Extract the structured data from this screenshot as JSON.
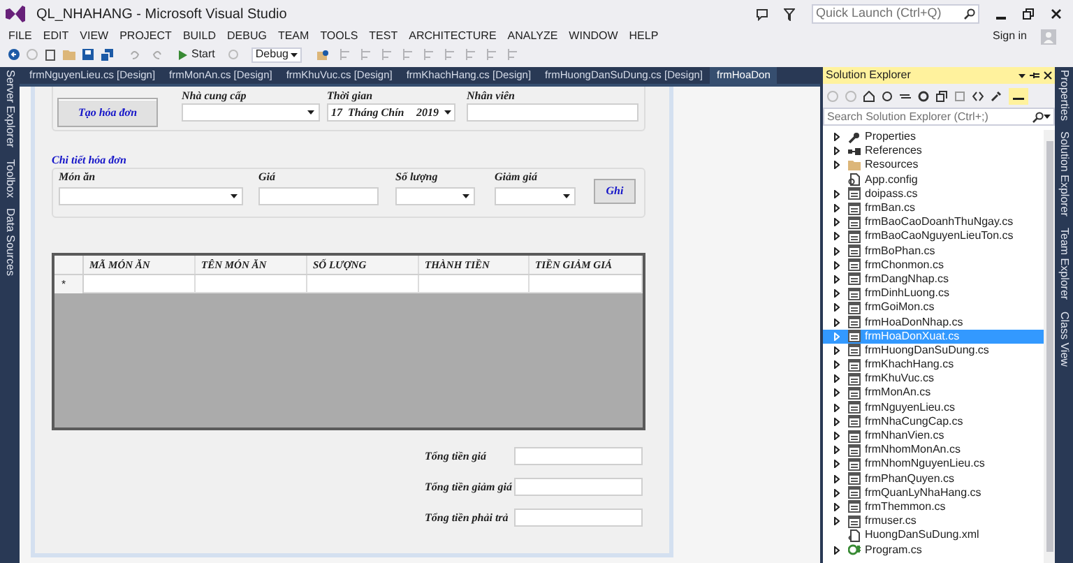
{
  "window": {
    "title": "QL_NHAHANG - Microsoft Visual Studio"
  },
  "quick_launch": {
    "placeholder": "Quick Launch (Ctrl+Q)"
  },
  "menu": [
    "FILE",
    "EDIT",
    "VIEW",
    "PROJECT",
    "BUILD",
    "DEBUG",
    "TEAM",
    "TOOLS",
    "TEST",
    "ARCHITECTURE",
    "ANALYZE",
    "WINDOW",
    "HELP"
  ],
  "sign_in": "Sign in",
  "toolbar": {
    "start": "Start",
    "configuration": "Debug"
  },
  "left_tool_tabs": [
    "Server Explorer",
    "Toolbox",
    "Data Sources"
  ],
  "document_tabs": [
    {
      "label": "frmNguyenLieu.cs [Design]",
      "selected": false
    },
    {
      "label": "frmMonAn.cs [Design]",
      "selected": false
    },
    {
      "label": "frmKhuVuc.cs [Design]",
      "selected": false
    },
    {
      "label": "frmKhachHang.cs [Design]",
      "selected": false
    },
    {
      "label": "frmHuongDanSuDung.cs [Design]",
      "selected": false
    },
    {
      "label": "frmHoaDon",
      "selected": true
    }
  ],
  "form": {
    "create_button": "Tạo hóa đơn",
    "top_fields": [
      {
        "label": "Nhà cung cấp",
        "kind": "combo"
      },
      {
        "label": "Thời gian",
        "kind": "date",
        "day": "17",
        "month": "Tháng Chín",
        "year": "2019"
      },
      {
        "label": "Nhân viên",
        "kind": "text"
      }
    ],
    "details": {
      "title": "Chi tiết hóa đơn",
      "fields": [
        {
          "label": "Món ăn",
          "kind": "combo"
        },
        {
          "label": "Giá",
          "kind": "text"
        },
        {
          "label": "Số lượng",
          "kind": "combo"
        },
        {
          "label": "Giảm giá",
          "kind": "combo"
        }
      ],
      "save_button": "Ghi"
    },
    "grid": {
      "columns": [
        "MÃ MÓN ĂN",
        "TÊN MÓN ĂN",
        "SỐ LƯỢNG",
        "THÀNH TIỀN",
        "TIỀN GIẢM GIÁ"
      ],
      "new_row_marker": "*"
    },
    "totals": [
      {
        "label": "Tổng tiền giá"
      },
      {
        "label": "Tổng tiền giảm giá"
      },
      {
        "label": "Tổng tiền phải trả"
      }
    ]
  },
  "solution_explorer": {
    "title": "Solution Explorer",
    "search": {
      "placeholder": "Search Solution Explorer (Ctrl+;)"
    },
    "items": [
      {
        "label": "Properties",
        "kind": "wrench",
        "expandable": true,
        "selected": false
      },
      {
        "label": "References",
        "kind": "references",
        "expandable": true,
        "selected": false
      },
      {
        "label": "Resources",
        "kind": "folder",
        "expandable": true,
        "selected": false
      },
      {
        "label": "App.config",
        "kind": "config",
        "expandable": false,
        "selected": false
      },
      {
        "label": "doipass.cs",
        "kind": "form",
        "expandable": true,
        "selected": false
      },
      {
        "label": "frmBan.cs",
        "kind": "form",
        "expandable": true,
        "selected": false
      },
      {
        "label": "frmBaoCaoDoanhThuNgay.cs",
        "kind": "form",
        "expandable": true,
        "selected": false
      },
      {
        "label": "frmBaoCaoNguyenLieuTon.cs",
        "kind": "form",
        "expandable": true,
        "selected": false
      },
      {
        "label": "frmBoPhan.cs",
        "kind": "form",
        "expandable": true,
        "selected": false
      },
      {
        "label": "frmChonmon.cs",
        "kind": "form",
        "expandable": true,
        "selected": false
      },
      {
        "label": "frmDangNhap.cs",
        "kind": "form",
        "expandable": true,
        "selected": false
      },
      {
        "label": "frmDinhLuong.cs",
        "kind": "form",
        "expandable": true,
        "selected": false
      },
      {
        "label": "frmGoiMon.cs",
        "kind": "form",
        "expandable": true,
        "selected": false
      },
      {
        "label": "frmHoaDonNhap.cs",
        "kind": "form",
        "expandable": true,
        "selected": false
      },
      {
        "label": "frmHoaDonXuat.cs",
        "kind": "form",
        "expandable": true,
        "selected": true
      },
      {
        "label": "frmHuongDanSuDung.cs",
        "kind": "form",
        "expandable": true,
        "selected": false
      },
      {
        "label": "frmKhachHang.cs",
        "kind": "form",
        "expandable": true,
        "selected": false
      },
      {
        "label": "frmKhuVuc.cs",
        "kind": "form",
        "expandable": true,
        "selected": false
      },
      {
        "label": "frmMonAn.cs",
        "kind": "form",
        "expandable": true,
        "selected": false
      },
      {
        "label": "frmNguyenLieu.cs",
        "kind": "form",
        "expandable": true,
        "selected": false
      },
      {
        "label": "frmNhaCungCap.cs",
        "kind": "form",
        "expandable": true,
        "selected": false
      },
      {
        "label": "frmNhanVien.cs",
        "kind": "form",
        "expandable": true,
        "selected": false
      },
      {
        "label": "frmNhomMonAn.cs",
        "kind": "form",
        "expandable": true,
        "selected": false
      },
      {
        "label": "frmNhomNguyenLieu.cs",
        "kind": "form",
        "expandable": true,
        "selected": false
      },
      {
        "label": "frmPhanQuyen.cs",
        "kind": "form",
        "expandable": true,
        "selected": false
      },
      {
        "label": "frmQuanLyNhaHang.cs",
        "kind": "form",
        "expandable": true,
        "selected": false
      },
      {
        "label": "frmThemmon.cs",
        "kind": "form",
        "expandable": true,
        "selected": false
      },
      {
        "label": "frmuser.cs",
        "kind": "form",
        "expandable": true,
        "selected": false
      },
      {
        "label": "HuongDanSuDung.xml",
        "kind": "xml",
        "expandable": false,
        "selected": false
      },
      {
        "label": "Program.cs",
        "kind": "code",
        "expandable": true,
        "selected": false
      }
    ]
  },
  "right_tool_tabs": [
    "Properties",
    "Solution Explorer",
    "Team Explorer",
    "Class View"
  ]
}
